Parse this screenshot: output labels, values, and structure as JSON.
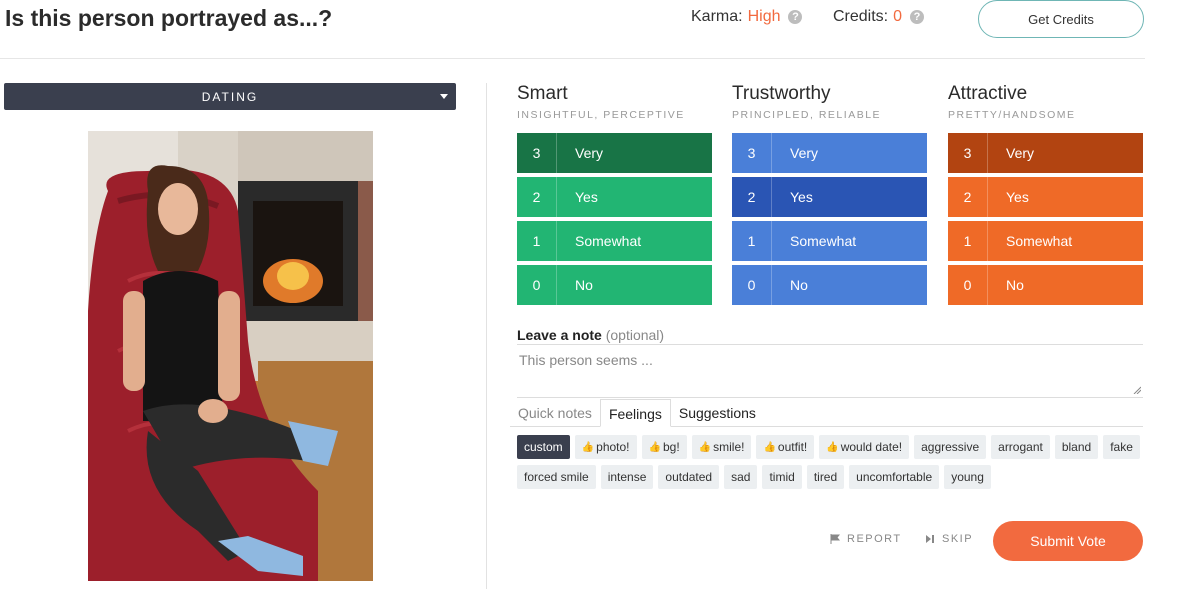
{
  "header": {
    "title": "Is this person portrayed as...?",
    "karma_label": "Karma:",
    "karma_value": "High",
    "credits_label": "Credits:",
    "credits_value": "0",
    "get_credits_label": "Get Credits",
    "help_icon": "?"
  },
  "category_select": {
    "value": "DATING"
  },
  "categories": [
    {
      "title": "Smart",
      "subtitle": "INSIGHTFUL, PERCEPTIVE",
      "colors": {
        "base": "#22b573",
        "selected": "#187446"
      },
      "options": [
        {
          "num": "3",
          "label": "Very",
          "selected": true
        },
        {
          "num": "2",
          "label": "Yes",
          "selected": false
        },
        {
          "num": "1",
          "label": "Somewhat",
          "selected": false
        },
        {
          "num": "0",
          "label": "No",
          "selected": false
        }
      ]
    },
    {
      "title": "Trustworthy",
      "subtitle": "PRINCIPLED, RELIABLE",
      "colors": {
        "base": "#4a7fd8",
        "selected": "#2a55b4"
      },
      "options": [
        {
          "num": "3",
          "label": "Very",
          "selected": false
        },
        {
          "num": "2",
          "label": "Yes",
          "selected": true
        },
        {
          "num": "1",
          "label": "Somewhat",
          "selected": false
        },
        {
          "num": "0",
          "label": "No",
          "selected": false
        }
      ]
    },
    {
      "title": "Attractive",
      "subtitle": "PRETTY/HANDSOME",
      "colors": {
        "base": "#ef6a27",
        "selected": "#b24411"
      },
      "options": [
        {
          "num": "3",
          "label": "Very",
          "selected": true
        },
        {
          "num": "2",
          "label": "Yes",
          "selected": false
        },
        {
          "num": "1",
          "label": "Somewhat",
          "selected": false
        },
        {
          "num": "0",
          "label": "No",
          "selected": false
        }
      ]
    }
  ],
  "note": {
    "label": "Leave a note",
    "optional": "(optional)",
    "placeholder": "This person seems ..."
  },
  "tabs": [
    {
      "label": "Quick notes",
      "active": false
    },
    {
      "label": "Feelings",
      "active": true
    },
    {
      "label": "Suggestions",
      "active": false
    }
  ],
  "chips_row1": [
    "custom",
    "photo!",
    "bg!",
    "smile!",
    "outfit!",
    "would date!",
    "aggressive",
    "arrogant",
    "bland",
    "fake"
  ],
  "chips_row2": [
    "forced smile",
    "intense",
    "outdated",
    "sad",
    "timid",
    "tired",
    "uncomfortable",
    "young"
  ],
  "actions": {
    "report": "REPORT",
    "skip": "SKIP",
    "submit": "Submit Vote"
  },
  "colors": {
    "accent": "#f26a3f",
    "dark": "#3a3f4e"
  }
}
